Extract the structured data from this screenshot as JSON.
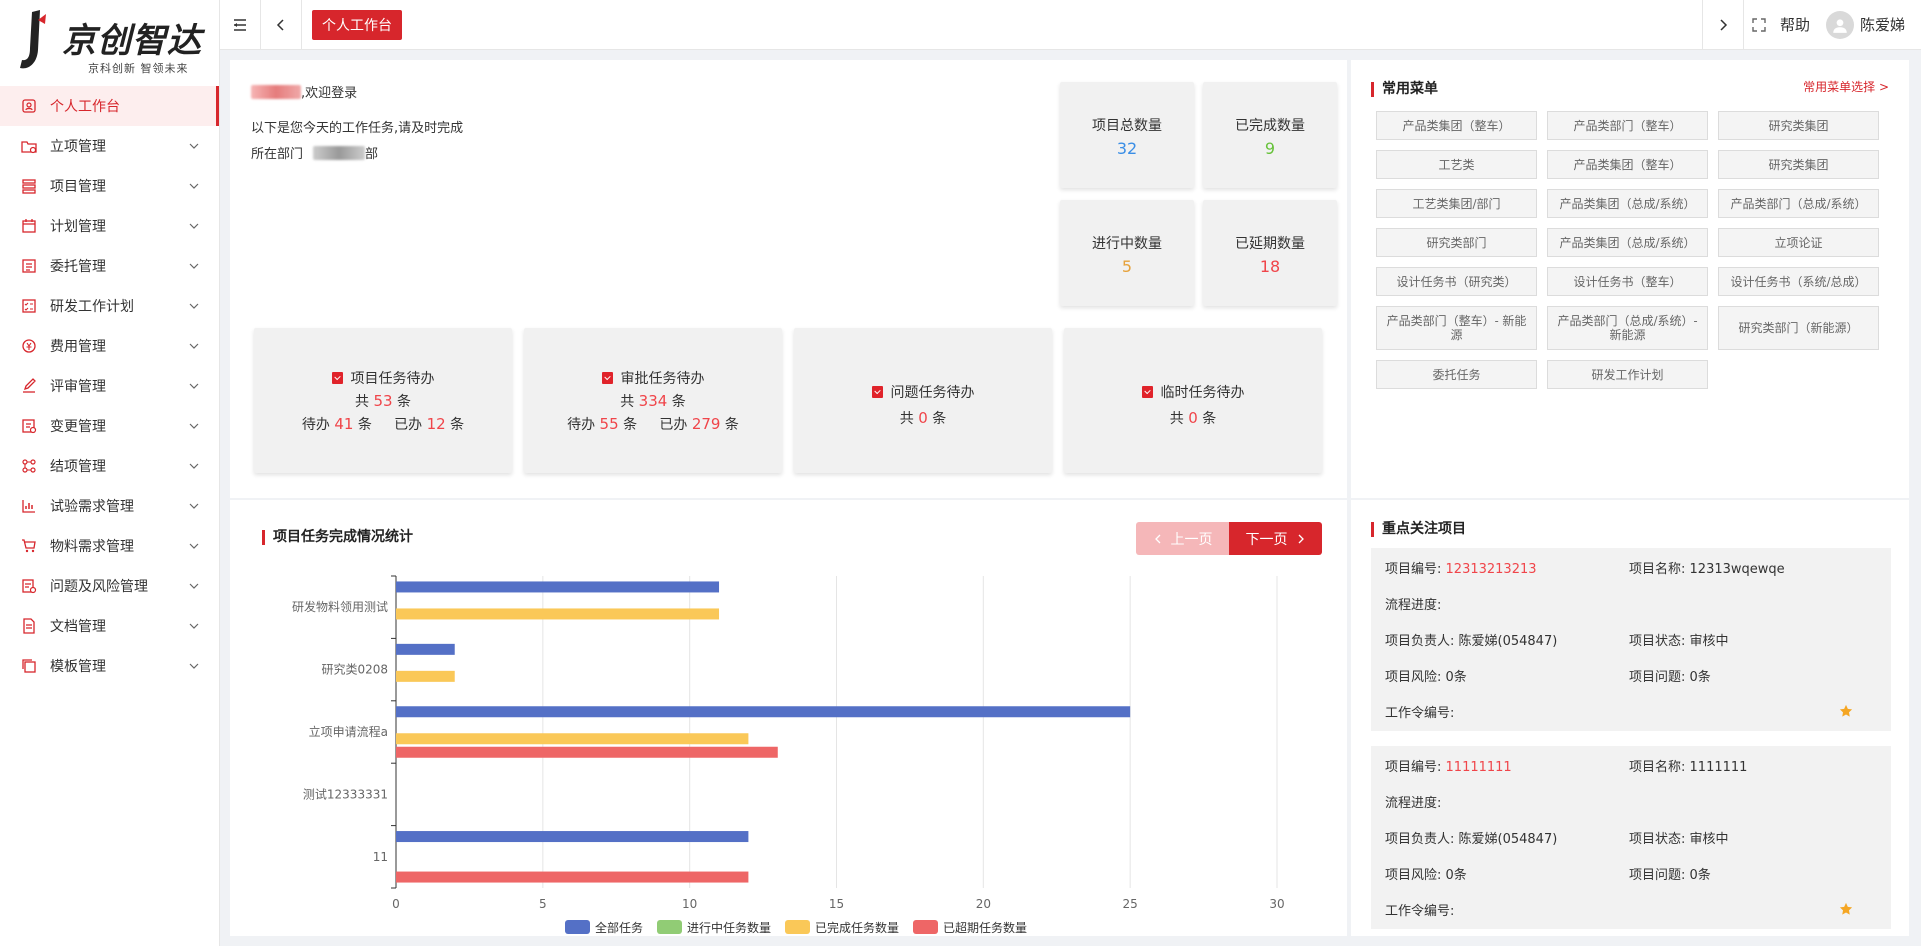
{
  "brand": {
    "title": "京创智达",
    "subtitle": "京科创新 智领未来"
  },
  "sidebar": {
    "items": [
      {
        "label": "个人工作台",
        "icon": "workbench-icon",
        "active": true
      },
      {
        "label": "立项管理",
        "icon": "folder-icon"
      },
      {
        "label": "项目管理",
        "icon": "stack-icon"
      },
      {
        "label": "计划管理",
        "icon": "calendar-icon"
      },
      {
        "label": "委托管理",
        "icon": "form-icon"
      },
      {
        "label": "研发工作计划",
        "icon": "tasks-icon"
      },
      {
        "label": "费用管理",
        "icon": "money-icon"
      },
      {
        "label": "评审管理",
        "icon": "edit-icon"
      },
      {
        "label": "变更管理",
        "icon": "change-icon"
      },
      {
        "label": "结项管理",
        "icon": "flow-icon"
      },
      {
        "label": "试验需求管理",
        "icon": "chart-icon"
      },
      {
        "label": "物料需求管理",
        "icon": "cart-icon"
      },
      {
        "label": "问题及风险管理",
        "icon": "risk-icon"
      },
      {
        "label": "文档管理",
        "icon": "doc-icon"
      },
      {
        "label": "模板管理",
        "icon": "copy-icon"
      }
    ]
  },
  "topbar": {
    "active_tab": "个人工作台",
    "help": "帮助",
    "user": "陈爱娣"
  },
  "welcome": {
    "greeting": ",欢迎登录",
    "tasks_today": "以下是您今天的工作任务,请及时完成",
    "dept_label": "所在部门",
    "dept_suffix": "部"
  },
  "stats": [
    {
      "label": "项目总数量",
      "value": "32",
      "color": "#3a8ee6"
    },
    {
      "label": "已完成数量",
      "value": "9",
      "color": "#67c23a"
    },
    {
      "label": "进行中数量",
      "value": "5",
      "color": "#e6a23c"
    },
    {
      "label": "已延期数量",
      "value": "18",
      "color": "#f0454a"
    }
  ],
  "todos": [
    {
      "title": "项目任务待办",
      "total_pre": "共",
      "total": "53",
      "total_post": "条",
      "pending_label": "待办",
      "pending": "41",
      "done_label": "已办",
      "done": "12",
      "unit": "条"
    },
    {
      "title": "审批任务待办",
      "total_pre": "共",
      "total": "334",
      "total_post": "条",
      "pending_label": "待办",
      "pending": "55",
      "done_label": "已办",
      "done": "279",
      "unit": "条"
    },
    {
      "title": "问题任务待办",
      "total_pre": "共",
      "total": "0",
      "total_post": "条"
    },
    {
      "title": "临时任务待办",
      "total_pre": "共",
      "total": "0",
      "total_post": "条"
    }
  ],
  "common_menu": {
    "title": "常用菜单",
    "select": "常用菜单选择 >",
    "items": [
      "产品类集团（整车）",
      "产品类部门（整车）",
      "研究类集团",
      "工艺类",
      "产品类集团（整车）",
      "研究类集团",
      "工艺类集团/部门",
      "产品类集团（总成/系统）",
      "产品类部门（总成/系统）",
      "研究类部门",
      "产品类集团（总成/系统）",
      "立项论证",
      "设计任务书（研究类）",
      "设计任务书（整车）",
      "设计任务书（系统/总成）",
      "产品类部门（整车）- 新能源",
      "产品类部门（总成/系统）- 新能源",
      "研究类部门（新能源）",
      "委托任务",
      "研发工作计划"
    ]
  },
  "chart_panel": {
    "title": "项目任务完成情况统计",
    "prev": "上一页",
    "next": "下一页"
  },
  "chart_data": {
    "type": "bar",
    "orientation": "horizontal",
    "categories": [
      "研发物料领用测试",
      "研究类0208",
      "立项申请流程a",
      "测试12333331",
      "11"
    ],
    "series": [
      {
        "name": "全部任务",
        "color": "#5470c6",
        "values": [
          11,
          2,
          25,
          0,
          12
        ]
      },
      {
        "name": "进行中任务数量",
        "color": "#91cc75",
        "values": [
          0,
          0,
          0,
          0,
          0
        ]
      },
      {
        "name": "已完成任务数量",
        "color": "#fac858",
        "values": [
          11,
          2,
          12,
          0,
          0
        ]
      },
      {
        "name": "已超期任务数量",
        "color": "#ee6666",
        "values": [
          0,
          0,
          13,
          0,
          12
        ]
      }
    ],
    "xlim": [
      0,
      30
    ],
    "xticks": [
      0,
      5,
      10,
      15,
      20,
      25,
      30
    ],
    "grid": true,
    "legend": "bottom"
  },
  "focus": {
    "title": "重点关注项目",
    "projects": [
      {
        "code_label": "项目编号:",
        "code": "12313213213",
        "name_label": "项目名称:",
        "name": "12313wqewqe",
        "progress_label": "流程进度:",
        "owner_label": "项目负责人:",
        "owner": "陈爱娣(054847)",
        "status_label": "项目状态:",
        "status": "审核中",
        "risk_label": "项目风险:",
        "risk": "0条",
        "issue_label": "项目问题:",
        "issue": "0条",
        "order_label": "工作令编号:"
      },
      {
        "code_label": "项目编号:",
        "code": "11111111",
        "name_label": "项目名称:",
        "name": "1111111",
        "progress_label": "流程进度:",
        "owner_label": "项目负责人:",
        "owner": "陈爱娣(054847)",
        "status_label": "项目状态:",
        "status": "审核中",
        "risk_label": "项目风险:",
        "risk": "0条",
        "issue_label": "项目问题:",
        "issue": "0条",
        "order_label": "工作令编号:"
      }
    ]
  }
}
